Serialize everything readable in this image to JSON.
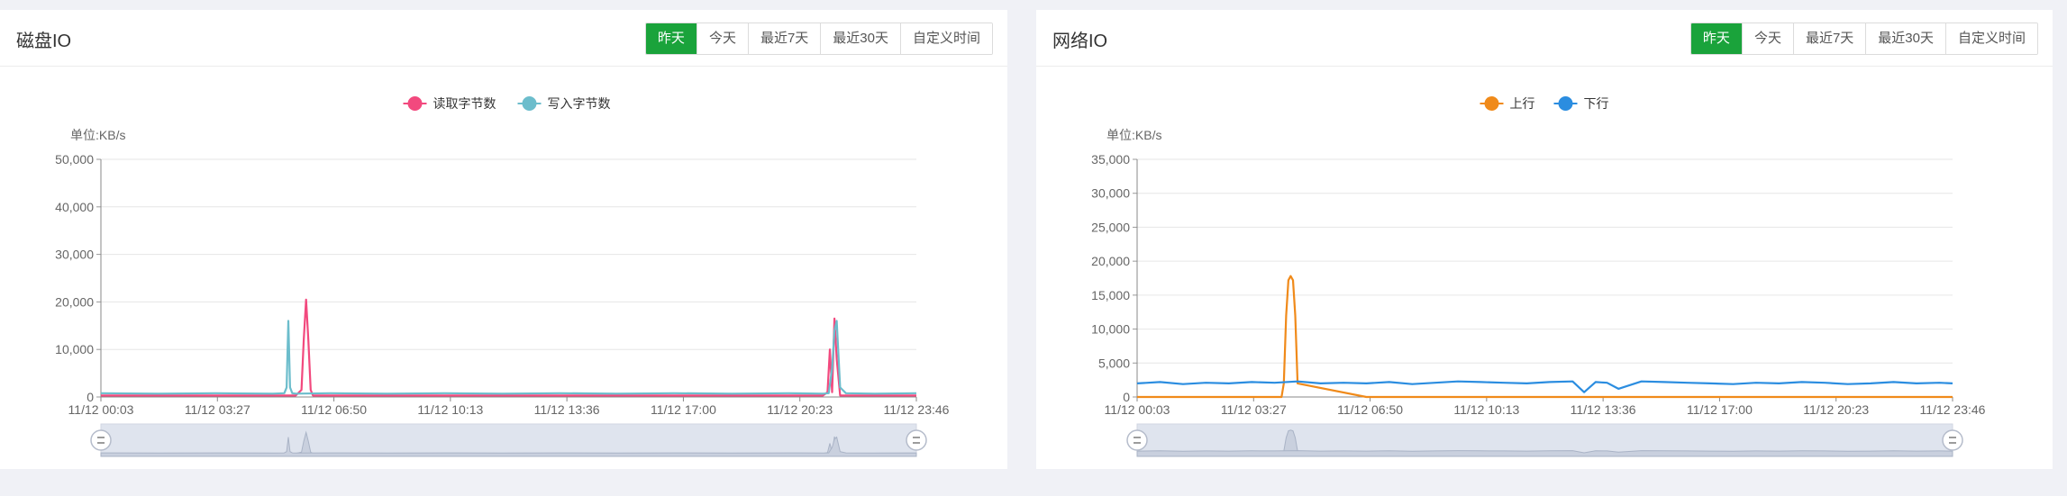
{
  "range_options": [
    "昨天",
    "今天",
    "最近7天",
    "最近30天",
    "自定义时间"
  ],
  "active_range": 0,
  "panels": [
    {
      "title": "磁盘IO",
      "chart_data": {
        "type": "line",
        "unit_label": "单位:KB/s",
        "ylim": [
          0,
          50000
        ],
        "yticks": [
          0,
          10000,
          20000,
          30000,
          40000,
          50000
        ],
        "ytick_labels": [
          "0",
          "10,000",
          "20,000",
          "30,000",
          "40,000",
          "50,000"
        ],
        "xtick_labels": [
          "11/12 00:03",
          "11/12 03:27",
          "11/12 06:50",
          "11/12 10:13",
          "11/12 13:36",
          "11/12 17:00",
          "11/12 20:23",
          "11/12 23:46"
        ],
        "xlim": [
          0,
          1423
        ],
        "grid": true,
        "legend_position": "top-center",
        "series": [
          {
            "name": "读取字节数",
            "color": "#f2497e",
            "x": [
              0,
              100,
              200,
              300,
              340,
              350,
              354,
              358,
              362,
              366,
              370,
              400,
              500,
              600,
              700,
              800,
              900,
              1000,
              1100,
              1200,
              1260,
              1268,
              1272,
              1276,
              1280,
              1284,
              1290,
              1300,
              1350,
              1423
            ],
            "y": [
              300,
              300,
              300,
              300,
              300,
              1500,
              12000,
              20500,
              12000,
              1500,
              300,
              300,
              300,
              300,
              300,
              300,
              300,
              300,
              300,
              300,
              300,
              1000,
              10000,
              1000,
              16500,
              8000,
              300,
              300,
              300,
              300
            ]
          },
          {
            "name": "写入字节数",
            "color": "#6cbdcc",
            "x": [
              0,
              100,
              200,
              300,
              320,
              324,
              327,
              330,
              334,
              340,
              400,
              500,
              600,
              700,
              800,
              900,
              1000,
              1100,
              1200,
              1260,
              1270,
              1276,
              1280,
              1284,
              1290,
              1300,
              1350,
              1423
            ],
            "y": [
              800,
              700,
              800,
              700,
              800,
              2000,
              16000,
              2000,
              800,
              700,
              800,
              700,
              800,
              700,
              800,
              700,
              800,
              700,
              800,
              700,
              800,
              6000,
              14000,
              16000,
              2000,
              800,
              700,
              800
            ]
          }
        ]
      }
    },
    {
      "title": "网络IO",
      "chart_data": {
        "type": "line",
        "unit_label": "单位:KB/s",
        "ylim": [
          0,
          35000
        ],
        "yticks": [
          0,
          5000,
          10000,
          15000,
          20000,
          25000,
          30000,
          35000
        ],
        "ytick_labels": [
          "0",
          "5,000",
          "10,000",
          "15,000",
          "20,000",
          "25,000",
          "30,000",
          "35,000"
        ],
        "xtick_labels": [
          "11/12 00:03",
          "11/12 03:27",
          "11/12 06:50",
          "11/12 10:13",
          "11/12 13:36",
          "11/12 17:00",
          "11/12 20:23",
          "11/12 23:46"
        ],
        "xlim": [
          0,
          1423
        ],
        "grid": true,
        "legend_position": "top-center",
        "series": [
          {
            "name": "上行",
            "color": "#f08a1a",
            "x": [
              0,
              100,
              200,
              252,
              256,
              260,
              264,
              268,
              272,
              276,
              280,
              400,
              600,
              800,
              1000,
              1200,
              1423
            ],
            "y": [
              0,
              0,
              0,
              0,
              2000,
              12000,
              17200,
              17800,
              17200,
              12000,
              2000,
              0,
              0,
              0,
              0,
              0,
              0
            ]
          },
          {
            "name": "下行",
            "color": "#2b8de0",
            "x": [
              0,
              40,
              80,
              120,
              160,
              200,
              240,
              280,
              320,
              360,
              400,
              440,
              480,
              520,
              560,
              600,
              640,
              680,
              720,
              760,
              780,
              800,
              820,
              840,
              880,
              920,
              960,
              1000,
              1040,
              1080,
              1120,
              1160,
              1200,
              1240,
              1280,
              1320,
              1360,
              1400,
              1423
            ],
            "y": [
              2000,
              2200,
              1900,
              2100,
              2000,
              2200,
              2100,
              2300,
              2000,
              2100,
              2000,
              2200,
              1900,
              2100,
              2300,
              2200,
              2100,
              2000,
              2200,
              2300,
              700,
              2200,
              2100,
              1200,
              2300,
              2200,
              2100,
              2000,
              1900,
              2100,
              2000,
              2200,
              2100,
              1900,
              2000,
              2200,
              2000,
              2100,
              2000
            ]
          }
        ]
      }
    }
  ]
}
